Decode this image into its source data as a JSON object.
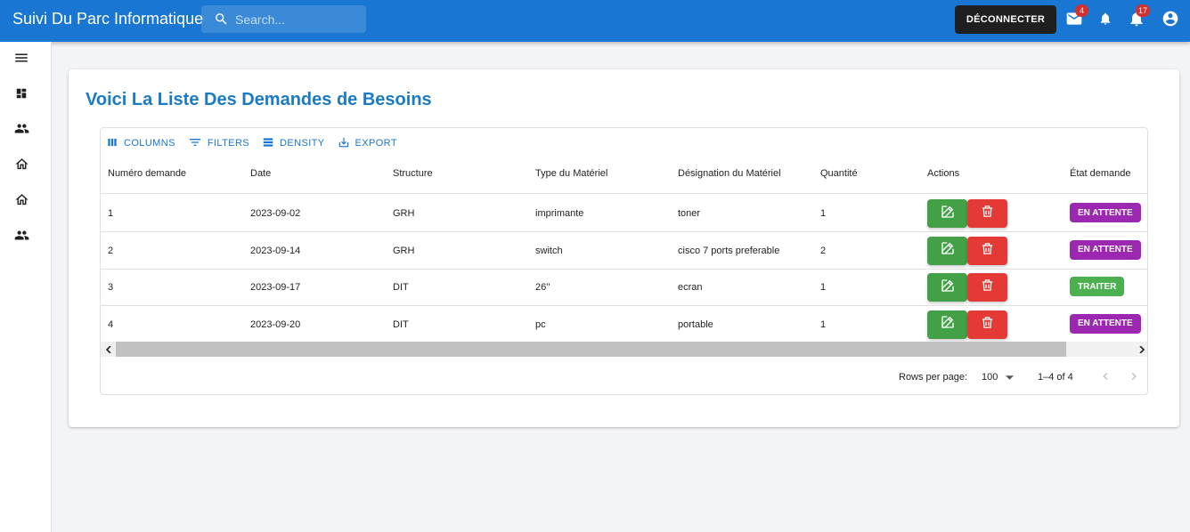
{
  "app": {
    "title": "Suivi Du Parc Informatique",
    "search_placeholder": "Search...",
    "logout_label": "DÉCONNECTER",
    "mail_badge": "4",
    "notifications_badge": "17",
    "brand_color": "#1976d2"
  },
  "sidebar": {
    "items": [
      {
        "icon": "menu-icon"
      },
      {
        "icon": "dashboard-icon"
      },
      {
        "icon": "people-icon"
      },
      {
        "icon": "home-icon"
      },
      {
        "icon": "home-outline-icon"
      },
      {
        "icon": "people-icon"
      }
    ]
  },
  "page": {
    "title": "Voici La Liste Des Demandes de Besoins"
  },
  "toolbar": {
    "columns": "COLUMNS",
    "filters": "FILTERS",
    "density": "DENSITY",
    "export": "EXPORT"
  },
  "table": {
    "headers": [
      "Numéro demande",
      "Date",
      "Structure",
      "Type du Matériel",
      "Désignation du Matériel",
      "Quantité",
      "Actions",
      "État demande"
    ],
    "rows": [
      {
        "numero": "1",
        "date": "2023-09-02",
        "structure": "GRH",
        "type": "imprimante",
        "designation": "toner",
        "quantite": "1",
        "etat": "EN ATTENTE"
      },
      {
        "numero": "2",
        "date": "2023-09-14",
        "structure": "GRH",
        "type": "switch",
        "designation": "cisco 7 ports preferable",
        "quantite": "2",
        "etat": "EN ATTENTE"
      },
      {
        "numero": "3",
        "date": "2023-09-17",
        "structure": "DIT",
        "type": "26''",
        "designation": "ecran",
        "quantite": "1",
        "etat": "TRAITER"
      },
      {
        "numero": "4",
        "date": "2023-09-20",
        "structure": "DIT",
        "type": "pc",
        "designation": "portable",
        "quantite": "1",
        "etat": "EN ATTENTE"
      }
    ],
    "status_colors": {
      "EN ATTENTE": "#9c27b0",
      "TRAITER": "#4caf50"
    }
  },
  "pagination": {
    "rows_per_page_label": "Rows per page:",
    "rows_per_page": "100",
    "range": "1–4 of 4"
  }
}
